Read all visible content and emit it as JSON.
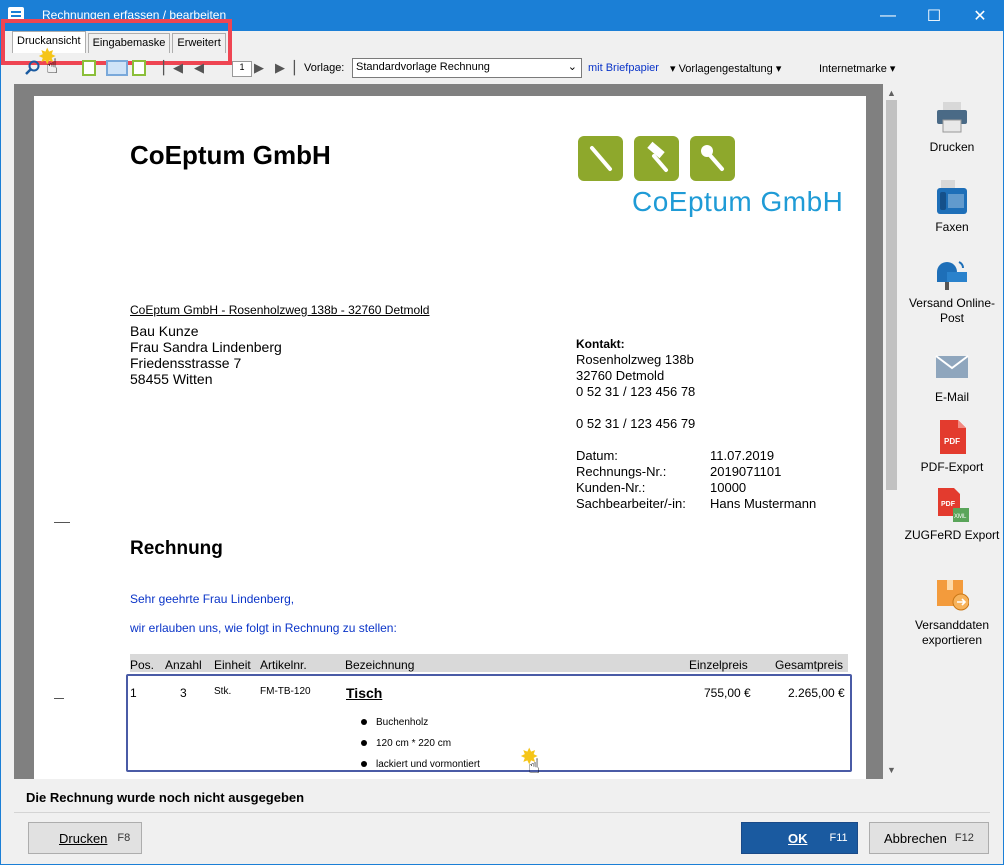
{
  "window": {
    "title": "Rechnungen erfassen / bearbeiten",
    "minimize_glyph": "—",
    "maximize_glyph": "☐",
    "close_glyph": "✕"
  },
  "tabs": [
    {
      "label": "Druckansicht",
      "active": true
    },
    {
      "label": "Eingabemaske",
      "active": false
    },
    {
      "label": "Erweitert",
      "active": false
    }
  ],
  "toolbar": {
    "page_number": "1",
    "vorlage_label": "Vorlage:",
    "vorlage_value": "Standardvorlage Rechnung",
    "briefpapier": "mit Briefpapier",
    "vorlagengestaltung": "Vorlagengestaltung",
    "internetmarke": "Internetmarke"
  },
  "document": {
    "company_name": "CoEptum GmbH",
    "logo_text": "CoEptum GmbH",
    "sender_line": "CoEptum GmbH - Rosenholzweg 138b - 32760 Detmold",
    "recipient": [
      "Bau Kunze",
      "Frau Sandra Lindenberg",
      "Friedensstrasse 7",
      "58455 Witten"
    ],
    "contact_label": "Kontakt:",
    "contact_lines": [
      "Rosenholzweg 138b",
      "32760 Detmold",
      "0 52 31 / 123 456 78",
      "",
      "0 52 31 / 123 456 79"
    ],
    "meta": [
      {
        "key": "Datum:",
        "value": "11.07.2019"
      },
      {
        "key": "Rechnungs-Nr.:",
        "value": "2019071101"
      },
      {
        "key": "Kunden-Nr.:",
        "value": "10000"
      },
      {
        "key": "Sachbearbeiter/-in:",
        "value": "Hans Mustermann"
      }
    ],
    "title": "Rechnung",
    "greeting": "Sehr geehrte Frau Lindenberg,",
    "intro": "wir erlauben uns, wie folgt in Rechnung zu stellen:",
    "table_headers": {
      "pos": "Pos.",
      "anzahl": "Anzahl",
      "einheit": "Einheit",
      "artikelnr": "Artikelnr.",
      "bezeichnung": "Bezeichnung",
      "einzelpreis": "Einzelpreis",
      "gesamtpreis": "Gesamtpreis"
    },
    "item": {
      "pos": "1",
      "anzahl": "3",
      "einheit": "Stk.",
      "artikelnr": "FM-TB-120",
      "bezeichnung": "Tisch",
      "einzelpreis": "755,00 €",
      "gesamtpreis": "2.265,00 €",
      "details": [
        "Buchenholz",
        "120 cm * 220 cm",
        "lackiert und vormontiert"
      ]
    }
  },
  "sidebar": [
    {
      "label": "Drucken",
      "icon": "printer-icon"
    },
    {
      "label": "Faxen",
      "icon": "fax-icon"
    },
    {
      "label": "Versand Online-Post",
      "icon": "mailbox-icon"
    },
    {
      "label": "E-Mail",
      "icon": "envelope-icon"
    },
    {
      "label": "PDF-Export",
      "icon": "pdf-icon"
    },
    {
      "label": "ZUGFeRD Export",
      "icon": "pdf-xml-icon"
    },
    {
      "label": "Versanddaten exportieren",
      "icon": "package-export-icon"
    }
  ],
  "status_message": "Die Rechnung wurde noch nicht ausgegeben",
  "buttons": {
    "print": {
      "label": "Drucken",
      "key": "F8"
    },
    "ok": {
      "label": "OK",
      "key": "F11"
    },
    "cancel": {
      "label": "Abbrechen",
      "key": "F12"
    }
  },
  "colors": {
    "title_bar": "#1b7fd6",
    "highlight": "#ef4552",
    "logo_green": "#8ea82c",
    "logo_blue": "#1f9bd6",
    "link_blue": "#0a34c8",
    "ok_button": "#1a5aa0"
  }
}
